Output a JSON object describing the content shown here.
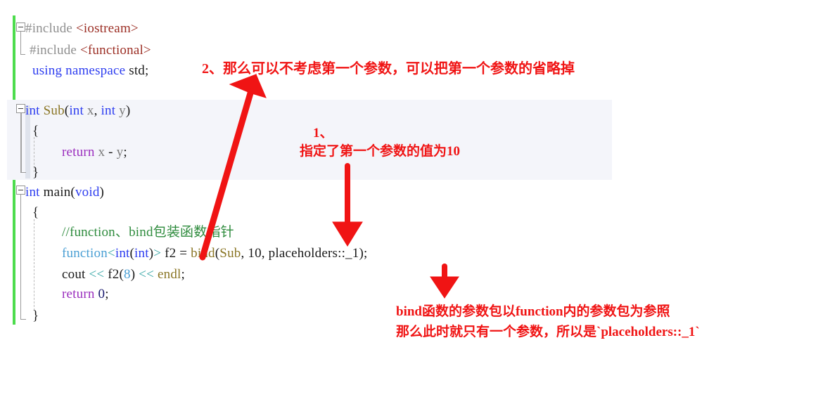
{
  "editor": {
    "name": "cpp-code-editor",
    "change_bar_color": "#4ddc4d",
    "block_highlight_color": "#f4f5fa",
    "code_lines": [
      {
        "id": "line-include-iostream",
        "segments": [
          {
            "t": "#include ",
            "c": "tok-pre"
          },
          {
            "t": "<iostream>",
            "c": "tok-header"
          }
        ]
      },
      {
        "id": "line-include-functional",
        "segments": [
          {
            "t": "#include ",
            "c": "tok-pre"
          },
          {
            "t": "<functional>",
            "c": "tok-header"
          }
        ]
      },
      {
        "id": "line-using-namespace",
        "segments": [
          {
            "t": "using namespace ",
            "c": "tok-kw"
          },
          {
            "t": "std;",
            "c": "tok-plain"
          }
        ]
      },
      {
        "id": "line-sub-signature",
        "segments": [
          {
            "t": "int ",
            "c": "tok-kw"
          },
          {
            "t": "Sub",
            "c": "tok-fn"
          },
          {
            "t": "(",
            "c": "tok-plain"
          },
          {
            "t": "int ",
            "c": "tok-kw"
          },
          {
            "t": "x",
            "c": "tok-param"
          },
          {
            "t": ", ",
            "c": "tok-plain"
          },
          {
            "t": "int ",
            "c": "tok-kw"
          },
          {
            "t": "y",
            "c": "tok-param"
          },
          {
            "t": ")",
            "c": "tok-plain"
          }
        ]
      },
      {
        "id": "line-sub-open-brace",
        "segments": [
          {
            "t": "{",
            "c": "tok-brace"
          }
        ]
      },
      {
        "id": "line-sub-return",
        "segments": [
          {
            "t": "return ",
            "c": "tok-ret"
          },
          {
            "t": "x",
            "c": "tok-param"
          },
          {
            "t": " - ",
            "c": "tok-plain"
          },
          {
            "t": "y",
            "c": "tok-param"
          },
          {
            "t": ";",
            "c": "tok-plain"
          }
        ]
      },
      {
        "id": "line-sub-close-brace",
        "segments": [
          {
            "t": "}",
            "c": "tok-brace"
          }
        ]
      },
      {
        "id": "line-main-signature",
        "segments": [
          {
            "t": "int ",
            "c": "tok-kw"
          },
          {
            "t": "main",
            "c": "tok-plain"
          },
          {
            "t": "(",
            "c": "tok-plain"
          },
          {
            "t": "void",
            "c": "tok-kw"
          },
          {
            "t": ")",
            "c": "tok-plain"
          }
        ]
      },
      {
        "id": "line-main-open-brace",
        "segments": [
          {
            "t": "{",
            "c": "tok-brace"
          }
        ]
      },
      {
        "id": "line-comment",
        "segments": [
          {
            "t": "//function、bind包装函数指针",
            "c": "tok-comment"
          }
        ]
      },
      {
        "id": "line-bind",
        "segments": [
          {
            "t": "function",
            "c": "tok-type"
          },
          {
            "t": "<",
            "c": "tok-op"
          },
          {
            "t": "int",
            "c": "tok-kw"
          },
          {
            "t": "(",
            "c": "tok-plain"
          },
          {
            "t": "int",
            "c": "tok-kw"
          },
          {
            "t": ")",
            "c": "tok-plain"
          },
          {
            "t": ">",
            "c": "tok-op"
          },
          {
            "t": " f2 = ",
            "c": "tok-plain"
          },
          {
            "t": "bind",
            "c": "tok-fn"
          },
          {
            "t": "(",
            "c": "tok-plain"
          },
          {
            "t": "Sub",
            "c": "tok-fn"
          },
          {
            "t": ", ",
            "c": "tok-plain"
          },
          {
            "t": "10",
            "c": "tok-plain"
          },
          {
            "t": ", placeholders::_1);",
            "c": "tok-plain"
          }
        ]
      },
      {
        "id": "line-cout",
        "segments": [
          {
            "t": "cout ",
            "c": "tok-plain"
          },
          {
            "t": "<< ",
            "c": "tok-op"
          },
          {
            "t": "f2",
            "c": "tok-plain"
          },
          {
            "t": "(",
            "c": "tok-plain"
          },
          {
            "t": "8",
            "c": "tok-type"
          },
          {
            "t": ") ",
            "c": "tok-plain"
          },
          {
            "t": "<< ",
            "c": "tok-op"
          },
          {
            "t": "endl",
            "c": "tok-stream"
          },
          {
            "t": ";",
            "c": "tok-plain"
          }
        ]
      },
      {
        "id": "line-main-return",
        "segments": [
          {
            "t": "return ",
            "c": "tok-ret"
          },
          {
            "t": "0",
            "c": "tok-num"
          },
          {
            "t": ";",
            "c": "tok-plain"
          }
        ]
      },
      {
        "id": "line-main-close-brace",
        "segments": [
          {
            "t": "}",
            "c": "tok-brace"
          }
        ]
      }
    ]
  },
  "annotations": {
    "color": "#f01414",
    "note_top": "2、那么可以不考虑第一个参数，可以把第一个参数的省略掉",
    "note_one_label": "1、",
    "note_one_text": "指定了第一个参数的值为10",
    "note_bottom_line1": "bind函数的参数包以function内的参数包为参照",
    "note_bottom_line2": "那么此时就只有一个参数，所以是`placeholders::_1`"
  }
}
